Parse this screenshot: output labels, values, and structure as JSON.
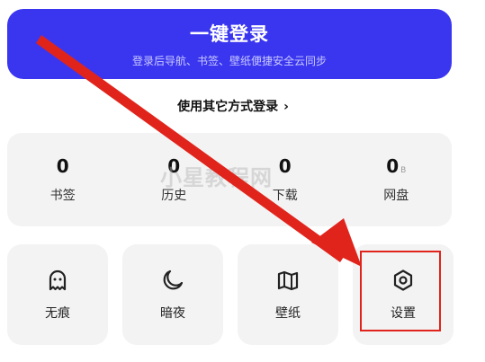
{
  "login": {
    "title": "一键登录",
    "subtitle": "登录后导航、书签、壁纸便捷安全云同步",
    "other_methods": "使用其它方式登录",
    "chevron": "›"
  },
  "stats": [
    {
      "value": "0",
      "unit": "",
      "label": "书签"
    },
    {
      "value": "0",
      "unit": "",
      "label": "历史"
    },
    {
      "value": "0",
      "unit": "",
      "label": "下载"
    },
    {
      "value": "0",
      "unit": "B",
      "label": "网盘"
    }
  ],
  "tools": [
    {
      "label": "无痕",
      "icon": "ghost-icon"
    },
    {
      "label": "暗夜",
      "icon": "moon-icon"
    },
    {
      "label": "壁纸",
      "icon": "map-icon"
    },
    {
      "label": "设置",
      "icon": "gear-icon"
    }
  ],
  "watermark": "小星教程网",
  "colors": {
    "accent": "#3a36f0",
    "highlight": "#e0241c",
    "card": "#f3f3f3"
  }
}
